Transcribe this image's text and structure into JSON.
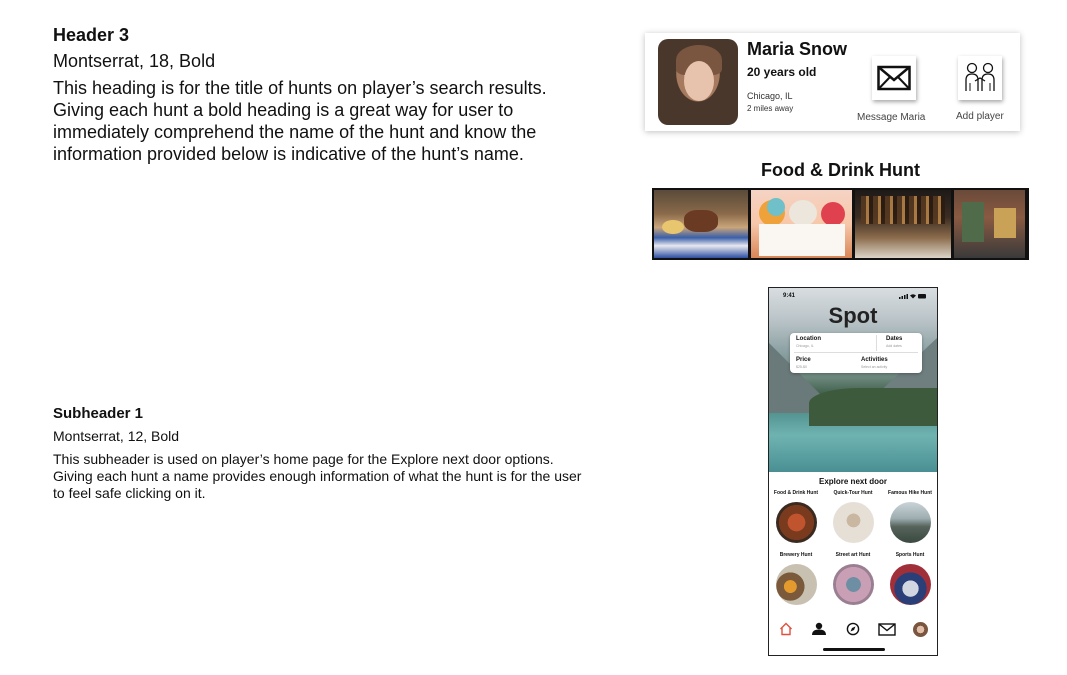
{
  "header3": {
    "title": "Header 3",
    "spec": "Montserrat, 18, Bold",
    "description": "This heading is for the title of hunts on player’s search results. Giving each hunt a bold heading is a great way for user to immediately comprehend the name of the hunt and know the information provided below is indicative of the hunt’s name."
  },
  "subheader1": {
    "title": "Subheader 1",
    "spec": "Montserrat, 12, Bold",
    "description": "This subheader is used on player’s home page for the Explore next door options. Giving each hunt a name provides enough information of what the hunt is for the user to feel safe clicking on it."
  },
  "player_card": {
    "name": "Maria Snow",
    "age": "20 years old",
    "location": "Chicago, IL",
    "distance": "2 miles away",
    "message_label": "Message Maria",
    "add_label": "Add player",
    "message_icon": "envelope-icon",
    "add_icon": "add-friend-icon"
  },
  "hunt_banner": {
    "title": "Food & Drink Hunt",
    "images": [
      "desserts-photo",
      "shaved-ice-photo",
      "bar-photo",
      "storefront-photo"
    ]
  },
  "phone": {
    "status_time": "9:41",
    "app_title": "Spot",
    "search": {
      "location_label": "Location",
      "location_placeholder": "Chicago, IL",
      "dates_label": "Dates",
      "dates_placeholder": "Add dates",
      "price_label": "Price",
      "price_placeholder": "$25-$0",
      "activities_label": "Activities",
      "activities_placeholder": "Select an activity"
    },
    "explore_title": "Explore next door",
    "categories": [
      {
        "label": "Food & Drink Hunt"
      },
      {
        "label": "Quick-Tour Hunt"
      },
      {
        "label": "Famous Hike Hunt"
      },
      {
        "label": "Brewery Hunt"
      },
      {
        "label": "Street art Hunt"
      },
      {
        "label": "Sports Hunt"
      }
    ],
    "tabs": [
      "home-icon",
      "players-icon",
      "compass-icon",
      "mail-icon",
      "profile-avatar"
    ],
    "colors": {
      "active_tab": "#e0503c",
      "ink": "#111111"
    }
  }
}
